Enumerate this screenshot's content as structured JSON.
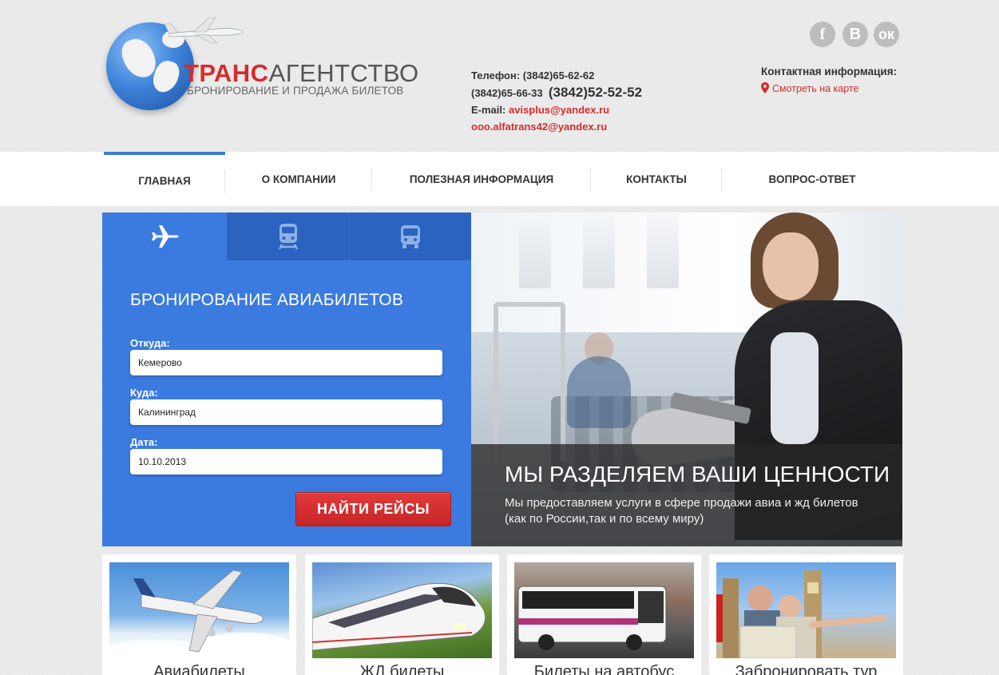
{
  "brand": {
    "name_red": "ТРАНС",
    "name_gray": "АГЕНТСТВО",
    "tagline": "БРОНИРОВАНИЕ И ПРОДАЖА БИЛЕТОВ"
  },
  "header": {
    "phone_line1": "Телефон: (3842)65-62-62",
    "phone_line2_small": "(3842)65-66-33",
    "phone_line2_big": "(3842)52-52-52",
    "email_label": "E-mail:",
    "email1": "avisplus@yandex.ru",
    "email2": "ooo.alfatrans42@yandex.ru",
    "contacts_title": "Контактная информация:",
    "map_link": "Смотреть на карте"
  },
  "social": [
    {
      "name": "facebook",
      "glyph": "f"
    },
    {
      "name": "vkontakte",
      "glyph": "B"
    },
    {
      "name": "odnoklassniki",
      "glyph": "ок"
    }
  ],
  "nav": {
    "items": [
      {
        "label": "ГЛАВНАЯ",
        "active": true
      },
      {
        "label": "О КОМПАНИИ",
        "active": false
      },
      {
        "label": "ПОЛЕЗНАЯ ИНФОРМАЦИЯ",
        "active": false
      },
      {
        "label": "КОНТАКТЫ",
        "active": false
      },
      {
        "label": "ВОПРОС-ОТВЕТ",
        "active": false
      }
    ]
  },
  "booking": {
    "tabs": [
      {
        "icon": "airplane-icon",
        "active": true
      },
      {
        "icon": "train-icon",
        "active": false
      },
      {
        "icon": "bus-icon",
        "active": false
      }
    ],
    "title": "БРОНИРОВАНИЕ АВИАБИЛЕТОВ",
    "from_label": "Откуда:",
    "from_value": "Кемерово",
    "to_label": "Куда:",
    "to_value": "Калининград",
    "date_label": "Дата:",
    "date_value": "10.10.2013",
    "search_button": "НАЙТИ РЕЙСЫ"
  },
  "hero": {
    "title": "МЫ РАЗДЕЛЯЕМ ВАШИ ЦЕННОСТИ",
    "text": "Мы предоставляем услуги в сфере продажи авиа и жд билетов (как по России,так и по всему миру)"
  },
  "cards": [
    {
      "label": "Авиабилеты"
    },
    {
      "label": "ЖД билеты"
    },
    {
      "label": "Билеты на автобус"
    },
    {
      "label": "Забронировать тур"
    }
  ],
  "colors": {
    "accent_blue": "#3b7bdf",
    "tab_dark_blue": "#2b63c0",
    "brand_red": "#d62c2c",
    "background": "#e9e9e9"
  }
}
